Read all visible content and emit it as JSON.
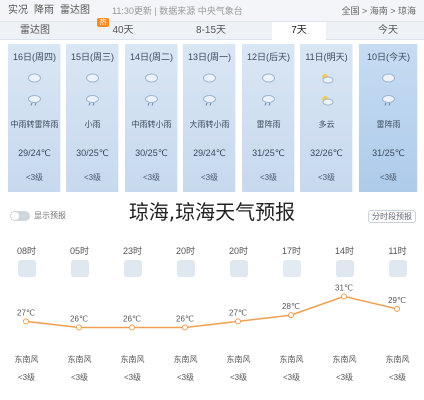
{
  "topbar": {
    "tabs": [
      {
        "label": "实况",
        "active": false
      },
      {
        "label": "降雨",
        "active": false
      },
      {
        "label": "雷达图",
        "active": false
      }
    ],
    "update_text": "11:30更新 | 数据来源 中央气象台",
    "breadcrumb": "全国 > 海南 > 琼海"
  },
  "range_tabs": [
    {
      "label": "雷达图",
      "active": false
    },
    {
      "label": "40天",
      "active": false,
      "badge": "hot"
    },
    {
      "label": "8-15天",
      "active": false
    },
    {
      "label": "7天",
      "active": true
    },
    {
      "label": "今天",
      "active": false
    }
  ],
  "days": [
    {
      "day": "16日(周四)",
      "cond": "中雨转雷阵雨",
      "temp": "29/24℃",
      "wind": "<3级"
    },
    {
      "day": "15日(周三)",
      "cond": "小雨",
      "temp": "30/25℃",
      "wind": "<3级"
    },
    {
      "day": "14日(周二)",
      "cond": "中雨转小雨",
      "temp": "30/25℃",
      "wind": "<3级"
    },
    {
      "day": "13日(周一)",
      "cond": "大雨转小雨",
      "temp": "29/24℃",
      "wind": "<3级"
    },
    {
      "day": "12日(后天)",
      "cond": "雷阵雨",
      "temp": "31/25℃",
      "wind": "<3级"
    },
    {
      "day": "11日(明天)",
      "cond": "多云",
      "temp": "32/26℃",
      "wind": "<3级"
    },
    {
      "day": "10日(今天)",
      "cond": "雷阵雨",
      "temp": "31/25℃",
      "wind": "<3级",
      "today": true
    }
  ],
  "title": "琼海,琼海天气预报",
  "toggle_label": "显示预报",
  "right_link": "分时段预报",
  "hours": [
    {
      "time": "08时",
      "temp": "27℃",
      "wind": "东南风",
      "level": "<3级",
      "icon": "rain-icon"
    },
    {
      "time": "05时",
      "temp": "26℃",
      "wind": "东南风",
      "level": "<3级",
      "icon": "rain-icon"
    },
    {
      "time": "23时",
      "temp": "26℃",
      "wind": "东南风",
      "level": "<3级",
      "icon": "rain-icon"
    },
    {
      "time": "20时",
      "temp": "26℃",
      "wind": "东南风",
      "level": "<3级",
      "icon": "rain-icon"
    },
    {
      "time": "20时",
      "temp": "27℃",
      "wind": "东南风",
      "level": "<3级",
      "icon": "rain-icon"
    },
    {
      "time": "17时",
      "temp": "28℃",
      "wind": "东南风",
      "level": "<3级",
      "icon": "cloud-sun-icon"
    },
    {
      "time": "14时",
      "temp": "31℃",
      "wind": "东南风",
      "level": "<3级",
      "icon": "thunder-icon"
    },
    {
      "time": "11时",
      "temp": "29℃",
      "wind": "东南风",
      "level": "<3级",
      "icon": "thunder-icon"
    }
  ],
  "chart_data": {
    "type": "line",
    "x": [
      "08时",
      "05时",
      "23时",
      "20时",
      "20时",
      "17时",
      "14时",
      "11时"
    ],
    "series": [
      {
        "values": [
          27,
          26,
          26,
          26,
          27,
          28,
          31,
          29
        ]
      }
    ],
    "colors": {
      "line": "#f0a050",
      "point": "#ffffff"
    }
  },
  "colors": {
    "accent": "#ff8a1f",
    "panel": "#c7d9ee"
  }
}
